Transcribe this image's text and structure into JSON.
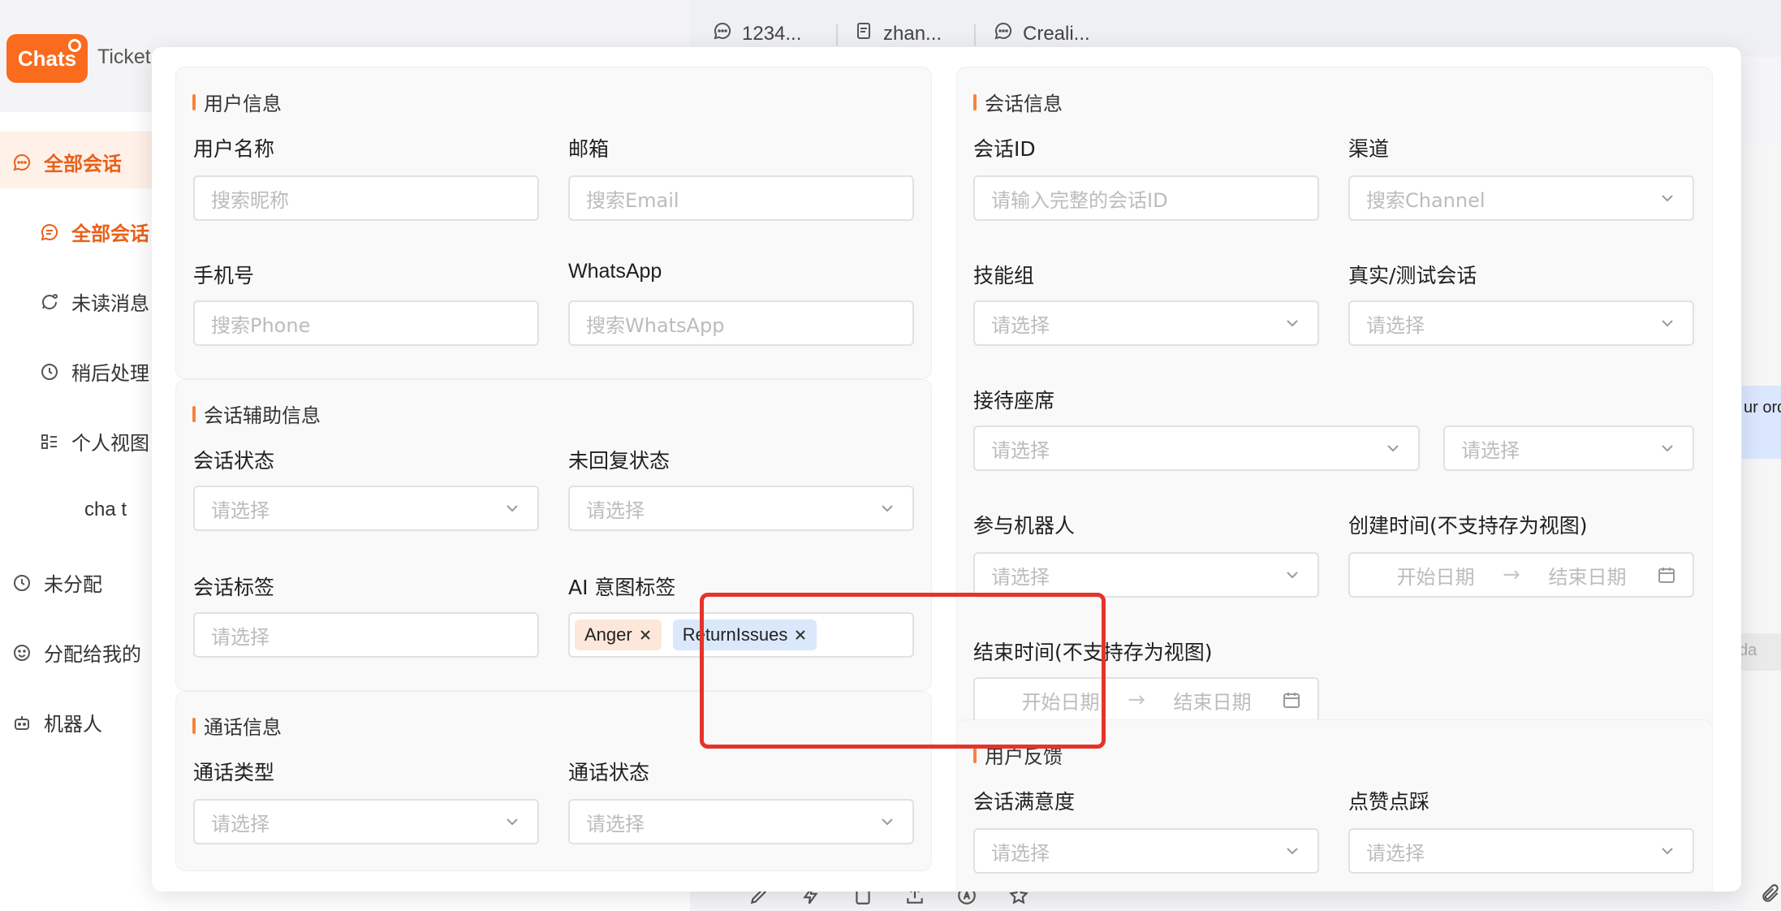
{
  "app": {
    "chats_label": "Chats",
    "tickets_label": "Ticket"
  },
  "sidebar": {
    "items": [
      {
        "label": "全部会话",
        "icon": "chat-bubble-icon"
      },
      {
        "label": "全部会话",
        "icon": "chat-circle-icon"
      },
      {
        "label": "未读消息",
        "icon": "unread-icon"
      },
      {
        "label": "稍后处理",
        "icon": "clock-icon"
      },
      {
        "label": "个人视图",
        "icon": "list-view-icon"
      },
      {
        "label": "cha t",
        "icon": ""
      },
      {
        "label": "未分配",
        "icon": "clock-icon"
      },
      {
        "label": "分配给我的",
        "icon": "smile-icon"
      },
      {
        "label": "机器人",
        "icon": "robot-icon"
      }
    ]
  },
  "top_tabs": [
    {
      "label": "1234...",
      "icon": "chat-bubble-icon"
    },
    {
      "label": "zhan...",
      "icon": "document-icon"
    },
    {
      "label": "Creali...",
      "icon": "chat-bubble-icon"
    }
  ],
  "background": {
    "bubble_text": "ur ord",
    "input_hint": "da"
  },
  "colors": {
    "brand": "#fa6b1e",
    "accent_bar": "#f5843d",
    "highlight": "#e6332a",
    "tag_orange": "#fde7da",
    "tag_blue": "#dbe8fb"
  },
  "filter": {
    "user_info": {
      "title": "用户信息",
      "name_label": "用户名称",
      "name_placeholder": "搜索昵称",
      "email_label": "邮箱",
      "email_placeholder": "搜索Email",
      "phone_label": "手机号",
      "phone_placeholder": "搜索Phone",
      "whatsapp_label": "WhatsApp",
      "whatsapp_placeholder": "搜索WhatsApp"
    },
    "aux_info": {
      "title": "会话辅助信息",
      "status_label": "会话状态",
      "status_placeholder": "请选择",
      "reply_label": "未回复状态",
      "reply_placeholder": "请选择",
      "tag_label": "会话标签",
      "tag_placeholder": "请选择",
      "ai_label": "AI 意图标签",
      "ai_tags": [
        "Anger",
        "ReturnIssues"
      ]
    },
    "call_info": {
      "title": "通话信息",
      "type_label": "通话类型",
      "type_placeholder": "请选择",
      "status_label": "通话状态",
      "status_placeholder": "请选择"
    },
    "session_info": {
      "title": "会话信息",
      "id_label": "会话ID",
      "id_placeholder": "请输入完整的会话ID",
      "channel_label": "渠道",
      "channel_placeholder": "搜索Channel",
      "skill_label": "技能组",
      "skill_placeholder": "请选择",
      "real_label": "真实/测试会话",
      "real_placeholder": "请选择",
      "agent_label": "接待座席",
      "agent_placeholder_1": "请选择",
      "agent_placeholder_2": "请选择",
      "bot_label": "参与机器人",
      "bot_placeholder": "请选择",
      "created_label": "创建时间(不支持存为视图)",
      "start_placeholder": "开始日期",
      "end_placeholder": "结束日期",
      "ended_label": "结束时间(不支持存为视图)"
    },
    "feedback": {
      "title": "用户反馈",
      "satisfaction_label": "会话满意度",
      "satisfaction_placeholder": "请选择",
      "like_label": "点赞点踩",
      "like_placeholder": "请选择"
    }
  }
}
